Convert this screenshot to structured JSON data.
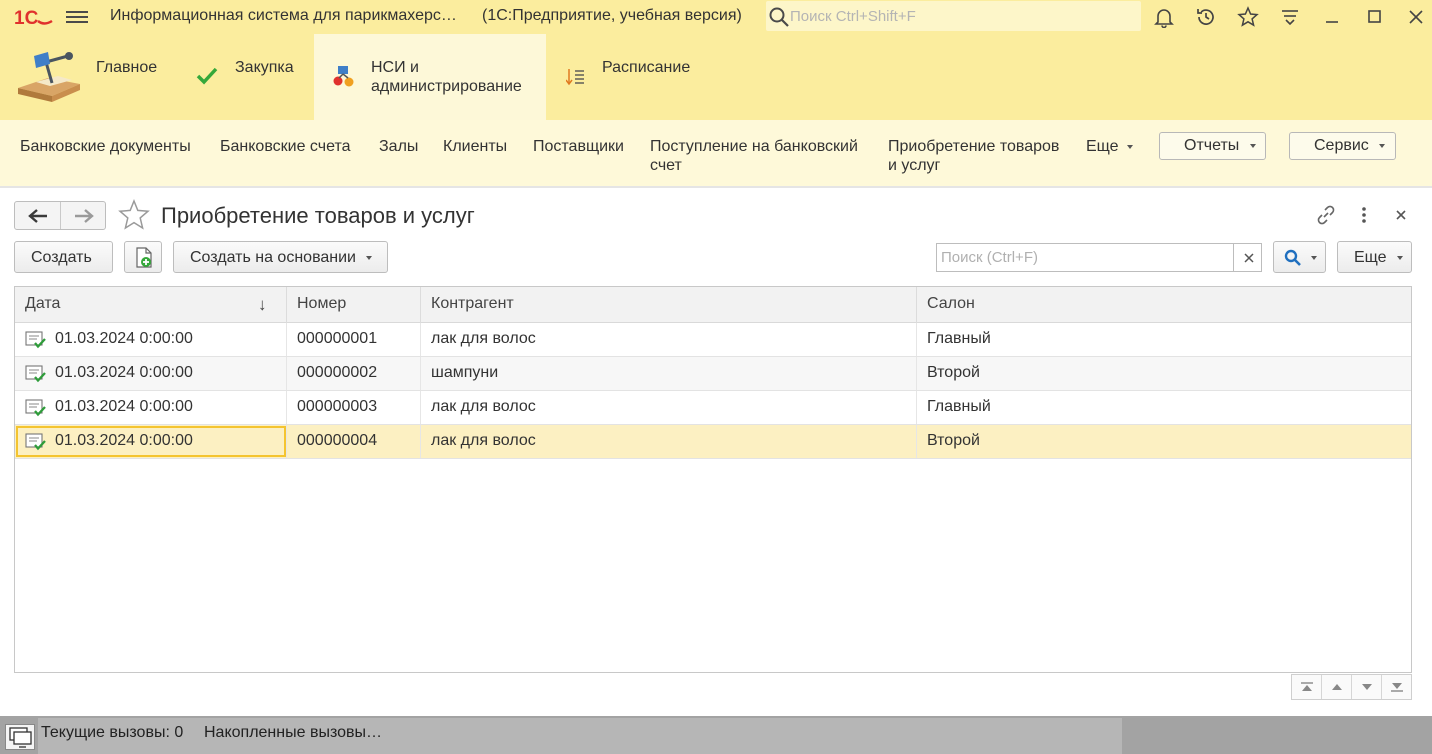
{
  "titlebar": {
    "title": "Информационная система для парикмахерс…",
    "subtitle": "(1С:Предприятие, учебная версия)",
    "search_placeholder": "Поиск Ctrl+Shift+F"
  },
  "sections": [
    {
      "label": "Главное",
      "icon": "desk-lamp-icon"
    },
    {
      "label": "Закупка",
      "icon": "checkmark-icon"
    },
    {
      "label": "НСИ и администрирование",
      "label_line1": "НСИ и",
      "label_line2": "администрирование",
      "icon": "admin-icon",
      "active": true
    },
    {
      "label": "Расписание",
      "icon": "schedule-icon"
    }
  ],
  "functions": {
    "items": [
      {
        "label": "Банковские документы"
      },
      {
        "label": "Банковские счета"
      },
      {
        "label": "Залы"
      },
      {
        "label": "Клиенты"
      },
      {
        "label": "Поставщики"
      },
      {
        "label_line1": "Поступление на банковский",
        "label_line2": "счет"
      },
      {
        "label_line1": "Приобретение товаров",
        "label_line2": "и услуг"
      }
    ],
    "more": "Еще",
    "reports": "Отчеты",
    "service": "Сервис"
  },
  "form": {
    "title": "Приобретение товаров и услуг",
    "create": "Создать",
    "create_based": "Создать на основании",
    "search_placeholder": "Поиск (Ctrl+F)",
    "more": "Еще"
  },
  "table": {
    "columns": [
      "Дата",
      "Номер",
      "Контрагент",
      "Салон"
    ],
    "sort_indicator": "↓",
    "rows": [
      {
        "date": "01.03.2024 0:00:00",
        "number": "000000001",
        "counterparty": "лак для волос",
        "salon": "Главный"
      },
      {
        "date": "01.03.2024 0:00:00",
        "number": "000000002",
        "counterparty": "шампуни",
        "salon": "Второй"
      },
      {
        "date": "01.03.2024 0:00:00",
        "number": "000000003",
        "counterparty": "лак для волос",
        "salon": "Главный"
      },
      {
        "date": "01.03.2024 0:00:00",
        "number": "000000004",
        "counterparty": "лак для волос",
        "salon": "Второй"
      }
    ],
    "selected_row": 4
  },
  "status": {
    "current_calls": "Текущие вызовы: 0",
    "accumulated_calls": "Накопленные вызовы…"
  },
  "colors": {
    "header_yellow": "#fbed9e",
    "function_bar": "#fef9d9",
    "selected_row": "#fcf0c2",
    "logo_red": "#e0312d",
    "accent_blue": "#1f6fbf"
  }
}
